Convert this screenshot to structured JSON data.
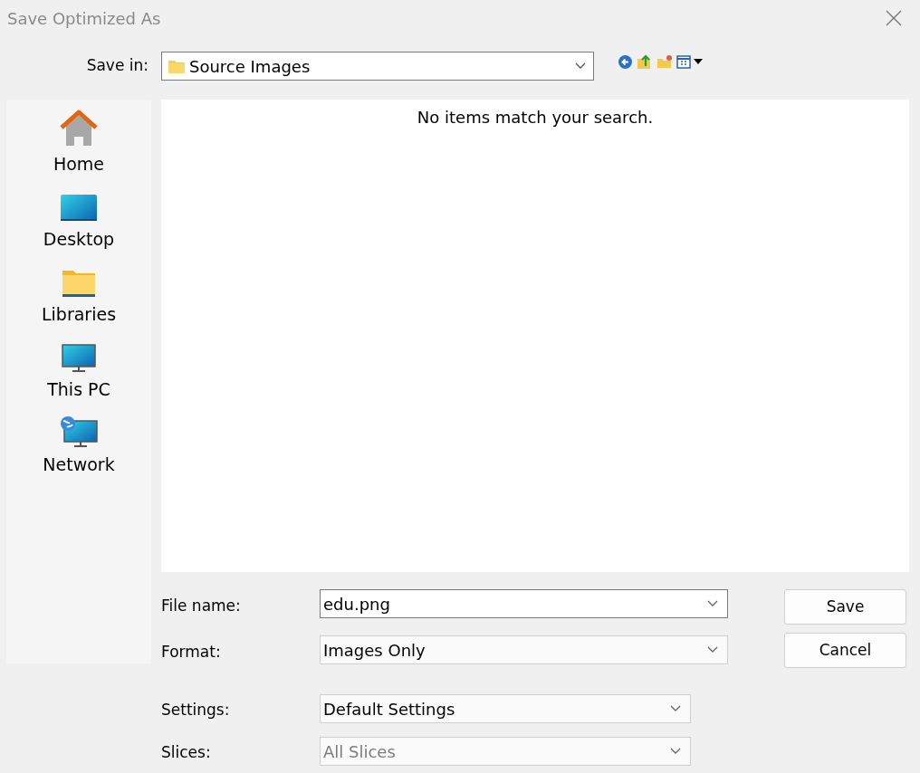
{
  "window": {
    "title": "Save Optimized As"
  },
  "save_in": {
    "label": "Save in:",
    "value": "Source Images"
  },
  "places": [
    {
      "label": "Home",
      "kind": "home"
    },
    {
      "label": "Desktop",
      "kind": "desktop"
    },
    {
      "label": "Libraries",
      "kind": "libraries"
    },
    {
      "label": "This PC",
      "kind": "pc"
    },
    {
      "label": "Network",
      "kind": "network"
    }
  ],
  "file_list": {
    "message": "No items match your search."
  },
  "fields": [
    {
      "label": "File name:",
      "value": "edu.png",
      "kind": "editable",
      "disabled": false
    },
    {
      "label": "Format:",
      "value": "Images Only",
      "kind": "select",
      "disabled": false
    },
    {
      "label": "Settings:",
      "value": "Default Settings",
      "kind": "select",
      "disabled": false
    },
    {
      "label": "Slices:",
      "value": "All Slices",
      "kind": "select",
      "disabled": true
    }
  ],
  "buttons": [
    "Save",
    "Cancel"
  ]
}
